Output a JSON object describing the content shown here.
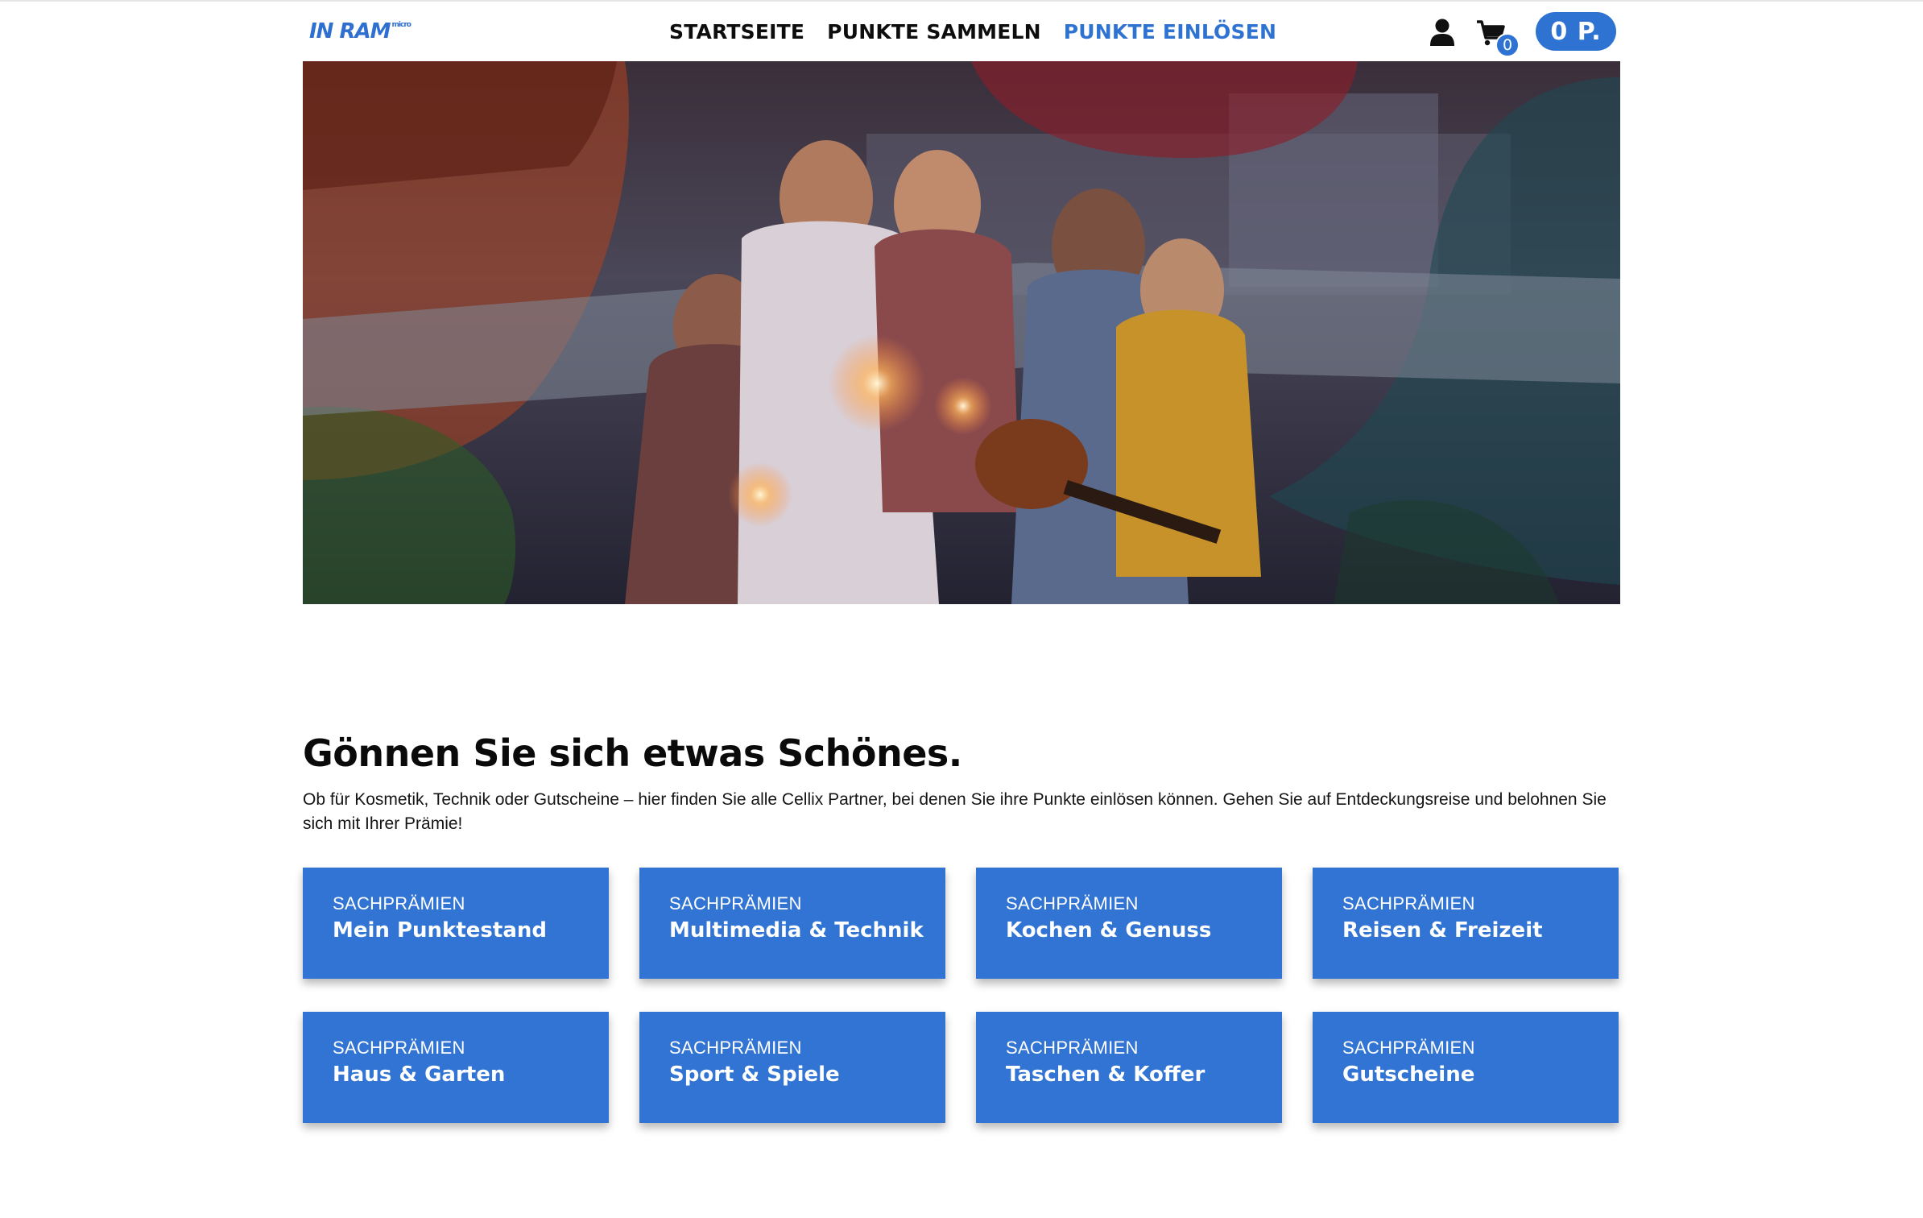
{
  "header": {
    "logo_text": "IN RAM",
    "logo_sup": "micro",
    "nav": [
      {
        "label": "STARTSEITE",
        "active": false
      },
      {
        "label": "PUNKTE SAMMELN",
        "active": false
      },
      {
        "label": "PUNKTE EINLÖSEN",
        "active": true
      }
    ],
    "cart_count": "0",
    "points": "0 P."
  },
  "hero": {
    "image": "group-of-friends-with-sparklers-on-rooftop-photo"
  },
  "main": {
    "headline": "Gönnen Sie sich etwas Schönes.",
    "intro": "Ob für Kosmetik, Technik oder Gutscheine – hier finden Sie alle Cellix Partner, bei denen Sie ihre Punkte einlösen können. Gehen Sie auf Entdeckungsreise und belohnen Sie sich mit Ihrer Prämie!",
    "tiles": [
      {
        "category": "SACHPRÄMIEN",
        "name": "Mein Punktestand"
      },
      {
        "category": "SACHPRÄMIEN",
        "name": "Multimedia & Technik"
      },
      {
        "category": "SACHPRÄMIEN",
        "name": "Kochen & Genuss"
      },
      {
        "category": "SACHPRÄMIEN",
        "name": "Reisen & Freizeit"
      },
      {
        "category": "SACHPRÄMIEN",
        "name": "Haus & Garten"
      },
      {
        "category": "SACHPRÄMIEN",
        "name": "Sport & Spiele"
      },
      {
        "category": "SACHPRÄMIEN",
        "name": "Taschen & Koffer"
      },
      {
        "category": "SACHPRÄMIEN",
        "name": "Gutscheine"
      }
    ]
  },
  "colors": {
    "accent": "#2f73d2",
    "tile": "#3174d4",
    "text": "#0a0a0a"
  }
}
